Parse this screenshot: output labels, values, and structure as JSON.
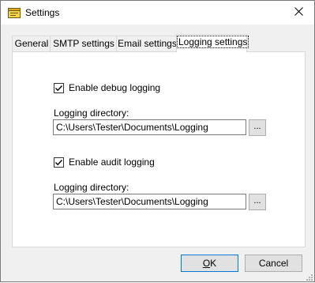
{
  "window": {
    "title": "Settings"
  },
  "tabs": [
    {
      "label": "General"
    },
    {
      "label": "SMTP settings"
    },
    {
      "label": "Email settings"
    },
    {
      "label": "Logging settings",
      "active": true
    }
  ],
  "debug": {
    "checkbox_label": "Enable debug logging",
    "checked": true,
    "dir_label": "Logging directory:",
    "dir_value": "C:\\Users\\Tester\\Documents\\Logging",
    "browse_label": "..."
  },
  "audit": {
    "checkbox_label": "Enable audit logging",
    "checked": true,
    "dir_label": "Logging directory:",
    "dir_value": "C:\\Users\\Tester\\Documents\\Logging",
    "browse_label": "..."
  },
  "buttons": {
    "ok_label": "OK",
    "cancel_label": "Cancel"
  },
  "icons": {
    "app": "settings-app-icon",
    "close": "close-icon",
    "check": "checkmark-icon",
    "grip": "resize-grip-icon"
  }
}
